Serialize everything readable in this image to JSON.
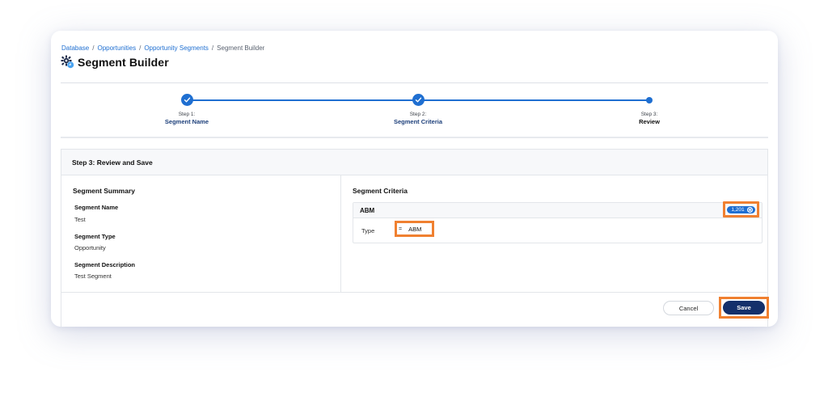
{
  "breadcrumb": {
    "items": [
      "Database",
      "Opportunities",
      "Opportunity Segments"
    ],
    "current": "Segment Builder",
    "separator": "/"
  },
  "page": {
    "title": "Segment Builder",
    "icon": "segment-gear-icon"
  },
  "stepper": {
    "steps": [
      {
        "number_label": "Step 1:",
        "name": "Segment Name",
        "status": "complete"
      },
      {
        "number_label": "Step 2:",
        "name": "Segment Criteria",
        "status": "complete"
      },
      {
        "number_label": "Step 3:",
        "name": "Review",
        "status": "current"
      }
    ]
  },
  "panel": {
    "title": "Step 3: Review and Save"
  },
  "summary": {
    "title": "Segment Summary",
    "fields": [
      {
        "label": "Segment Name",
        "value": "Test"
      },
      {
        "label": "Segment Type",
        "value": "Opportunity"
      },
      {
        "label": "Segment Description",
        "value": "Test Segment"
      }
    ]
  },
  "criteria": {
    "title": "Segment Criteria",
    "group_name": "ABM",
    "count": "1,201",
    "rule": {
      "field": "Type",
      "operator": "=",
      "value": "ABM"
    }
  },
  "footer": {
    "cancel_label": "Cancel",
    "save_label": "Save"
  },
  "colors": {
    "accent": "#1f6fd1",
    "primary_button": "#14306b",
    "highlight": "#f08030"
  }
}
